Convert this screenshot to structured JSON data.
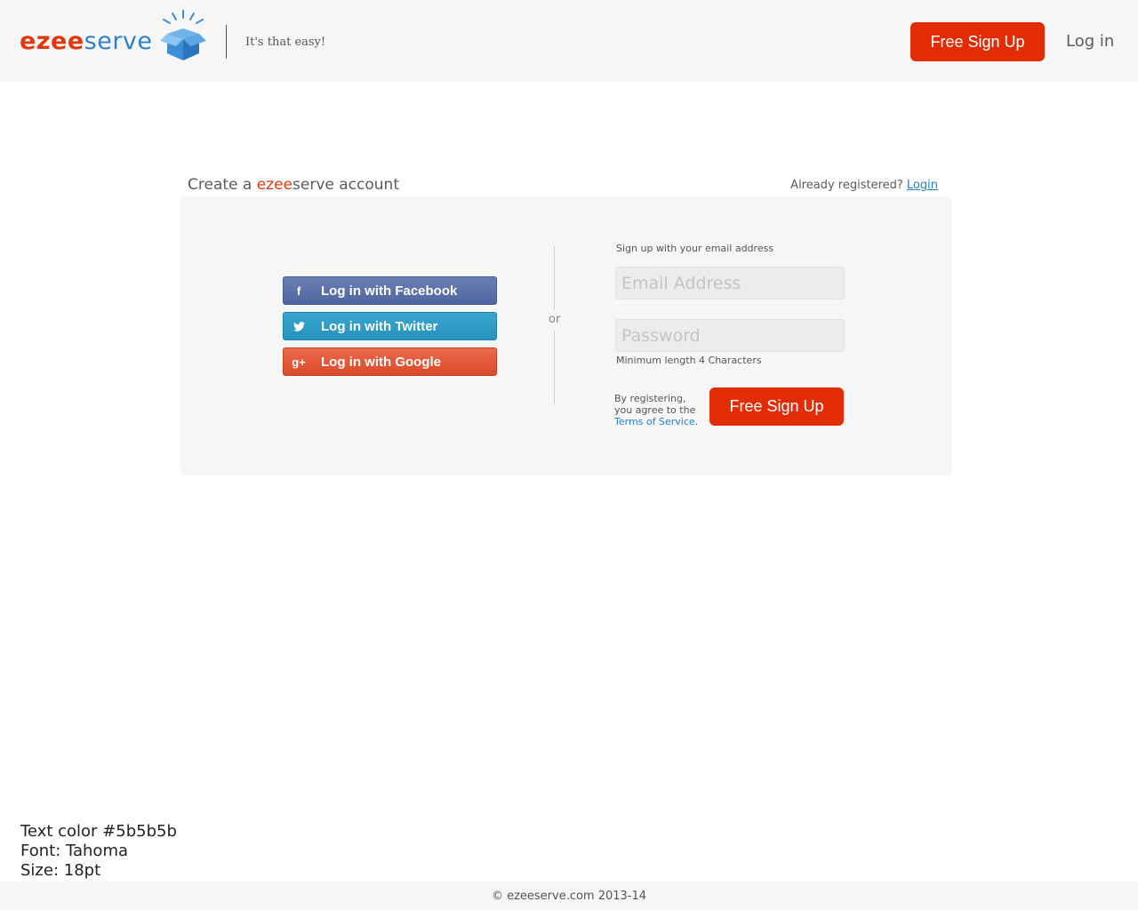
{
  "header": {
    "logo_part1": "ezee",
    "logo_part2": "serve",
    "tagline": "It's that easy!",
    "signup_button": "Free Sign Up",
    "login_link": "Log in"
  },
  "main": {
    "title_prefix": "Create a ",
    "title_brand1": "ezee",
    "title_brand2": "serve",
    "title_suffix": " account",
    "already_registered": "Already registered?",
    "login_link": "Login",
    "social": {
      "facebook": "Log in with Facebook",
      "twitter": "Log in with Twitter",
      "google": "Log in with Google"
    },
    "or": "or",
    "signup_label": "Sign up with your email address",
    "email_placeholder": "Email Address",
    "password_placeholder": "Password",
    "min_length": "Minimum length 4 Characters",
    "terms_prefix": "By registering, you agree to the",
    "terms_link": "Terms of Service",
    "terms_suffix": ".",
    "signup_button": "Free Sign Up"
  },
  "notes": {
    "line1": "Text color #5b5b5b",
    "line2": "Font: Tahoma",
    "line3": "Size: 18pt"
  },
  "footer": {
    "copyright": "© ezeeserve.com 2013-14"
  },
  "colors": {
    "accent": "#e12c04",
    "brand_blue": "#2f80c8",
    "text": "#5b5b5b",
    "facebook": "#5870aa",
    "twitter": "#2d9cc6",
    "google": "#e0542f"
  }
}
